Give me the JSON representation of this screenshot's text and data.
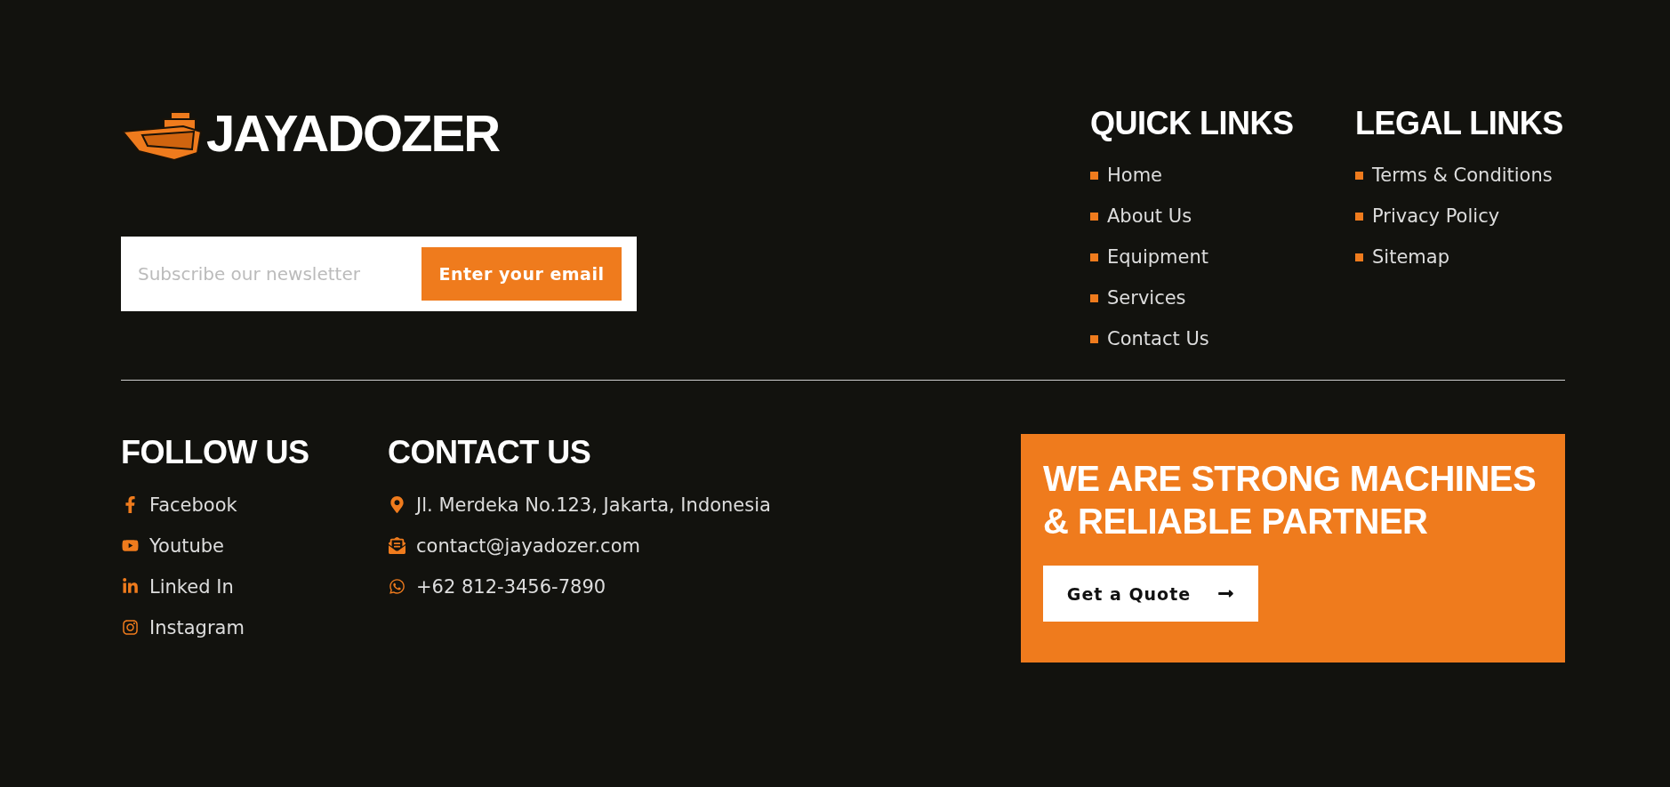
{
  "brand": {
    "name": "JAYADOZER"
  },
  "newsletter": {
    "placeholder": "Subscribe our newsletter",
    "button": "Enter your email"
  },
  "quick_links": {
    "title": "QUICK LINKS",
    "items": [
      "Home",
      "About Us",
      "Equipment",
      "Services",
      "Contact Us"
    ]
  },
  "legal_links": {
    "title": "LEGAL LINKS",
    "items": [
      "Terms & Conditions",
      "Privacy Policy",
      "Sitemap"
    ]
  },
  "follow_us": {
    "title": "FOLLOW US",
    "items": [
      {
        "kind": "facebook",
        "label": "Facebook"
      },
      {
        "kind": "youtube",
        "label": "Youtube"
      },
      {
        "kind": "linkedin",
        "label": "Linked In"
      },
      {
        "kind": "instagram",
        "label": "Instagram"
      }
    ]
  },
  "contact_us": {
    "title": "CONTACT US",
    "items": [
      {
        "kind": "address",
        "label": "Jl. Merdeka No.123, Jakarta, Indonesia"
      },
      {
        "kind": "email",
        "label": "contact@jayadozer.com"
      },
      {
        "kind": "phone",
        "label": "+62 812-3456-7890"
      }
    ]
  },
  "cta": {
    "headline": "WE ARE STRONG MACHINES & RELIABLE PARTNER",
    "button": "Get a Quote"
  }
}
